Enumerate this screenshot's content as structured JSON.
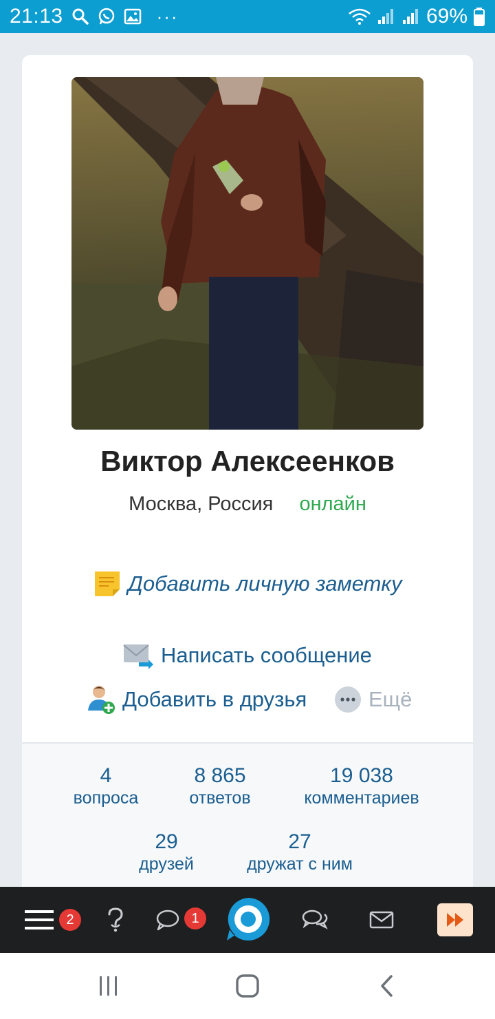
{
  "status_bar": {
    "time": "21:13",
    "battery": "69%",
    "more": "···"
  },
  "profile": {
    "name": "Виктор Алексеенков",
    "location": "Москва, Россия",
    "status": "онлайн"
  },
  "actions": {
    "note": "Добавить личную заметку",
    "message": "Написать сообщение",
    "add_friend": "Добавить в друзья",
    "more": "Ещё"
  },
  "stats": [
    {
      "value": "4",
      "label": "вопроса"
    },
    {
      "value": "8 865",
      "label": "ответов"
    },
    {
      "value": "19 038",
      "label": "комментариев"
    },
    {
      "value": "29",
      "label": "друзей"
    },
    {
      "value": "27",
      "label": "дружат с ним"
    }
  ],
  "app_nav": {
    "menu_badge": "2",
    "comments_badge": "1",
    "icons": [
      "menu-icon",
      "question-icon",
      "comment-icon",
      "home-logo-icon",
      "chat-icon",
      "mail-icon",
      "fast-forward-icon"
    ]
  },
  "colors": {
    "status_bar": "#0d9ed1",
    "link": "#1b5e8f",
    "online": "#2fa84f",
    "badge": "#e53935",
    "nav_bg": "#1e1f21",
    "logo": "#1a9ad6"
  }
}
